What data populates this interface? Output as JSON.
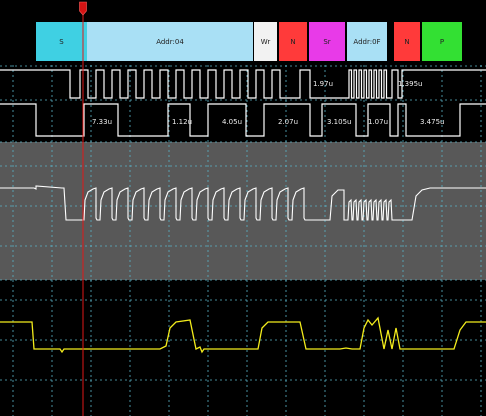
{
  "decode_bar": {
    "segments": [
      {
        "label": "S",
        "color": "#3fd0e3"
      },
      {
        "label": "Addr:04",
        "color": "#a9e0f5"
      },
      {
        "label": "Wr",
        "color": "#f2f2f2"
      },
      {
        "label": "N",
        "color": "#ff3a3a"
      },
      {
        "label": "Sr",
        "color": "#e83ae8"
      },
      {
        "label": "Addr:0F",
        "color": "#a9e0f5"
      },
      {
        "label": "N",
        "color": "#ff3a3a"
      },
      {
        "label": "P",
        "color": "#33e033"
      }
    ]
  },
  "timing_top": [
    {
      "text": "1.97u"
    },
    {
      "text": "1.395u"
    }
  ],
  "timing_bottom": [
    {
      "text": "7.33u"
    },
    {
      "text": "1.12u"
    },
    {
      "text": "4.05u"
    },
    {
      "text": "2.07u"
    },
    {
      "text": "3.105u"
    },
    {
      "text": "1.07u"
    },
    {
      "text": "3.475u"
    }
  ],
  "colors": {
    "background": "#000000",
    "analog_band": "#585858",
    "grid": "#5ab4c8",
    "trace_white": "#ffffff",
    "trace_yellow": "#f3ec1c",
    "cursor": "#e01818"
  },
  "cursor_marker": {
    "color": "#d41414"
  }
}
